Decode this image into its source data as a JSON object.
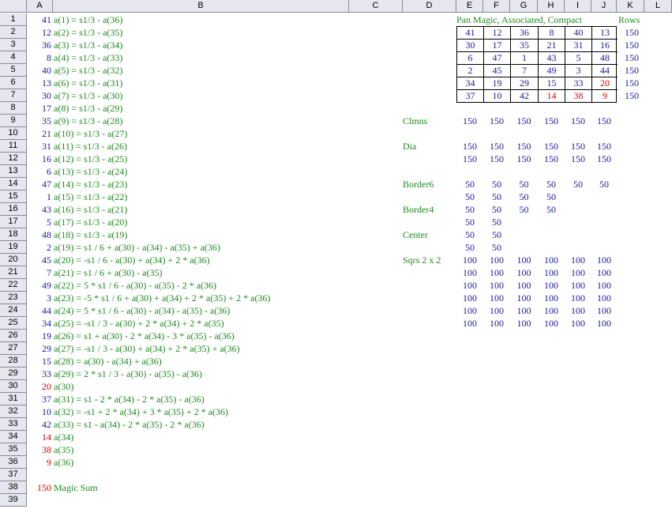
{
  "columns": [
    "A",
    "B",
    "C",
    "D",
    "E",
    "F",
    "G",
    "H",
    "I",
    "J",
    "K",
    "L"
  ],
  "rows": [
    "1",
    "2",
    "3",
    "4",
    "5",
    "6",
    "7",
    "8",
    "9",
    "10",
    "11",
    "12",
    "13",
    "14",
    "15",
    "16",
    "17",
    "18",
    "19",
    "20",
    "21",
    "22",
    "23",
    "24",
    "25",
    "26",
    "27",
    "28",
    "29",
    "30",
    "31",
    "32",
    "33",
    "34",
    "35",
    "36",
    "37",
    "38",
    "39"
  ],
  "colA": [
    {
      "v": "41",
      "c": "n"
    },
    {
      "v": "12",
      "c": "n"
    },
    {
      "v": "36",
      "c": "n"
    },
    {
      "v": "8",
      "c": "n"
    },
    {
      "v": "40",
      "c": "n"
    },
    {
      "v": "13",
      "c": "n"
    },
    {
      "v": "30",
      "c": "n"
    },
    {
      "v": "17",
      "c": "n"
    },
    {
      "v": "35",
      "c": "n"
    },
    {
      "v": "21",
      "c": "n"
    },
    {
      "v": "31",
      "c": "n"
    },
    {
      "v": "16",
      "c": "n"
    },
    {
      "v": "6",
      "c": "n"
    },
    {
      "v": "47",
      "c": "n"
    },
    {
      "v": "1",
      "c": "n"
    },
    {
      "v": "43",
      "c": "n"
    },
    {
      "v": "5",
      "c": "n"
    },
    {
      "v": "48",
      "c": "n"
    },
    {
      "v": "2",
      "c": "n"
    },
    {
      "v": "45",
      "c": "n"
    },
    {
      "v": "7",
      "c": "n"
    },
    {
      "v": "49",
      "c": "n"
    },
    {
      "v": "3",
      "c": "n"
    },
    {
      "v": "44",
      "c": "n"
    },
    {
      "v": "34",
      "c": "n"
    },
    {
      "v": "19",
      "c": "n"
    },
    {
      "v": "29",
      "c": "n"
    },
    {
      "v": "15",
      "c": "n"
    },
    {
      "v": "33",
      "c": "n"
    },
    {
      "v": "20",
      "c": "r"
    },
    {
      "v": "37",
      "c": "n"
    },
    {
      "v": "10",
      "c": "n"
    },
    {
      "v": "42",
      "c": "n"
    },
    {
      "v": "14",
      "c": "r"
    },
    {
      "v": "38",
      "c": "r"
    },
    {
      "v": "9",
      "c": "r"
    },
    {
      "v": "",
      "c": "n"
    },
    {
      "v": "150",
      "c": "r"
    },
    {
      "v": "",
      "c": "n"
    }
  ],
  "colB": [
    "a(1) = s1/3 - a(36)",
    "a(2) = s1/3 - a(35)",
    "a(3) = s1/3 - a(34)",
    "a(4) = s1/3 - a(33)",
    "a(5) = s1/3 - a(32)",
    "a(6) = s1/3 - a(31)",
    "a(7) = s1/3 - a(30)",
    "a(8) = s1/3 - a(29)",
    "a(9) = s1/3 - a(28)",
    "a(10) = s1/3 - a(27)",
    "a(11) = s1/3 - a(26)",
    "a(12) = s1/3 - a(25)",
    "a(13) = s1/3 - a(24)",
    "a(14) = s1/3 - a(23)",
    "a(15) = s1/3 - a(22)",
    "a(16) = s1/3 - a(21)",
    "a(17) = s1/3 - a(20)",
    "a(18) = s1/3 - a(19)",
    "a(19) = s1 / 6 + a(30) - a(34) - a(35) + a(36)",
    "a(20) = -s1 / 6 - a(30) + a(34) + 2 * a(36)",
    "a(21) = s1 / 6 + a(30) - a(35)",
    "a(22) = 5 * s1 / 6 - a(30) - a(35) - 2 * a(36)",
    "a(23) = -5 * s1 / 6 + a(30) + a(34) + 2 * a(35) + 2 * a(36)",
    "a(24) = 5 * s1 / 6 - a(30) - a(34) - a(35) - a(36)",
    "a(25) = -s1 / 3 - a(30) + 2 * a(34) + 2 * a(35)",
    "a(26) = s1 + a(30) - 2 * a(34) - 3 * a(35) - a(36)",
    "a(27) = -s1 / 3 - a(30) + a(34) + 2 * a(35) + a(36)",
    "a(28) = a(30) - a(34) + a(36)",
    "a(29) = 2 * s1 / 3 - a(30) - a(35) - a(36)",
    "a(30)",
    "a(31) = s1 - 2 * a(34) - 2 * a(35) - a(36)",
    "a(32) = -s1 + 2 * a(34) + 3 * a(35) + 2 * a(36)",
    "a(33) = s1 - a(34) - 2 * a(35) - 2 * a(36)",
    "a(34)",
    "a(35)",
    "a(36)",
    "",
    "Magic Sum",
    ""
  ],
  "title": "Pan Magic, Associated, Compact",
  "rows_label": "Rows",
  "square": [
    [
      {
        "v": "41",
        "c": "n"
      },
      {
        "v": "12",
        "c": "n"
      },
      {
        "v": "36",
        "c": "n"
      },
      {
        "v": "8",
        "c": "n"
      },
      {
        "v": "40",
        "c": "n"
      },
      {
        "v": "13",
        "c": "n"
      }
    ],
    [
      {
        "v": "30",
        "c": "n"
      },
      {
        "v": "17",
        "c": "n"
      },
      {
        "v": "35",
        "c": "n"
      },
      {
        "v": "21",
        "c": "n"
      },
      {
        "v": "31",
        "c": "n"
      },
      {
        "v": "16",
        "c": "n"
      }
    ],
    [
      {
        "v": "6",
        "c": "n"
      },
      {
        "v": "47",
        "c": "n"
      },
      {
        "v": "1",
        "c": "n"
      },
      {
        "v": "43",
        "c": "n"
      },
      {
        "v": "5",
        "c": "n"
      },
      {
        "v": "48",
        "c": "n"
      }
    ],
    [
      {
        "v": "2",
        "c": "n"
      },
      {
        "v": "45",
        "c": "n"
      },
      {
        "v": "7",
        "c": "n"
      },
      {
        "v": "49",
        "c": "n"
      },
      {
        "v": "3",
        "c": "n"
      },
      {
        "v": "44",
        "c": "n"
      }
    ],
    [
      {
        "v": "34",
        "c": "n"
      },
      {
        "v": "19",
        "c": "n"
      },
      {
        "v": "29",
        "c": "n"
      },
      {
        "v": "15",
        "c": "n"
      },
      {
        "v": "33",
        "c": "n"
      },
      {
        "v": "20",
        "c": "r"
      }
    ],
    [
      {
        "v": "37",
        "c": "n"
      },
      {
        "v": "10",
        "c": "n"
      },
      {
        "v": "42",
        "c": "n"
      },
      {
        "v": "14",
        "c": "r"
      },
      {
        "v": "38",
        "c": "r"
      },
      {
        "v": "9",
        "c": "r"
      }
    ]
  ],
  "row_sums": [
    "150",
    "150",
    "150",
    "150",
    "150",
    "150"
  ],
  "labels": {
    "clmns": "Clmns",
    "dia": "Dia",
    "border6": "Border6",
    "border4": "Border4",
    "center": "Center",
    "sqrs": "Sqrs 2 x 2"
  },
  "clmns": [
    "150",
    "150",
    "150",
    "150",
    "150",
    "150"
  ],
  "dia": [
    [
      "150",
      "150",
      "150",
      "150",
      "150",
      "150"
    ],
    [
      "150",
      "150",
      "150",
      "150",
      "150",
      "150"
    ]
  ],
  "border6": [
    [
      "50",
      "50",
      "50",
      "50",
      "50",
      "50"
    ],
    [
      "50",
      "50",
      "50",
      "50"
    ]
  ],
  "border4": [
    [
      "50",
      "50",
      "50",
      "50"
    ],
    [
      "50",
      "50"
    ]
  ],
  "center": [
    [
      "50",
      "50"
    ],
    [
      "50",
      "50"
    ]
  ],
  "sqrs": [
    [
      "100",
      "100",
      "100",
      "100",
      "100",
      "100"
    ],
    [
      "100",
      "100",
      "100",
      "100",
      "100",
      "100"
    ],
    [
      "100",
      "100",
      "100",
      "100",
      "100",
      "100"
    ],
    [
      "100",
      "100",
      "100",
      "100",
      "100",
      "100"
    ],
    [
      "100",
      "100",
      "100",
      "100",
      "100",
      "100"
    ],
    [
      "100",
      "100",
      "100",
      "100",
      "100",
      "100"
    ]
  ]
}
